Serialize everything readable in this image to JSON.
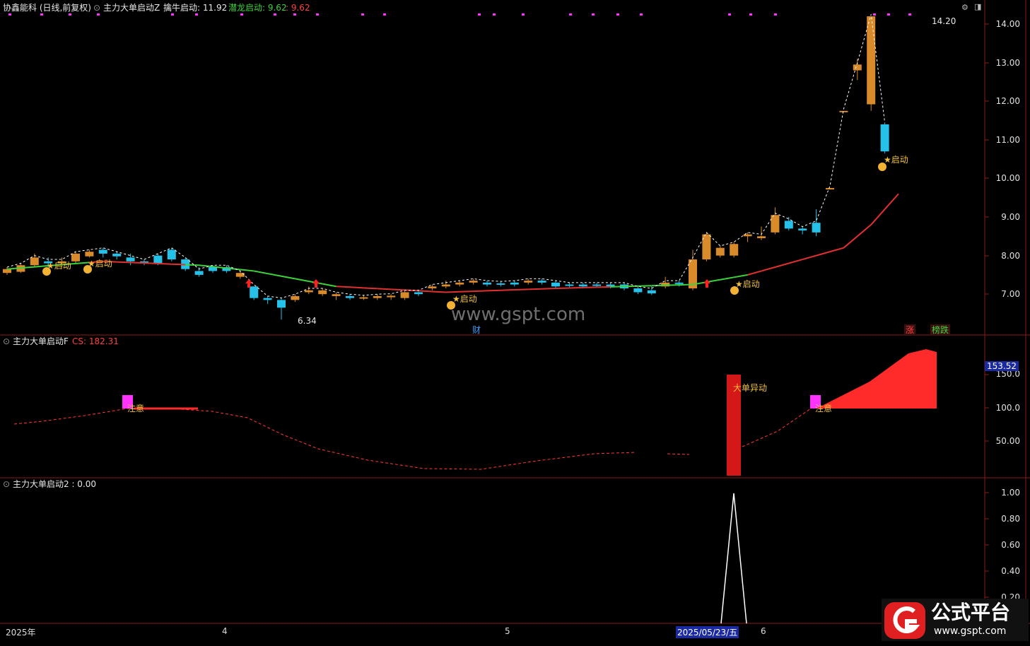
{
  "header": {
    "stock": "协鑫能科 (日线,前复权)",
    "indicator1": "主力大单启动Z",
    "qn_label": "擒牛启动: 11.92",
    "ql_label": "潜龙启动: 9.62",
    "ql_extra": ": 9.62"
  },
  "panel2": {
    "title": "主力大单启动F",
    "cs_label": "CS: 182.31",
    "current_value": "153.52",
    "event_label": "大单异动",
    "note_label": "注意"
  },
  "panel3": {
    "title": "主力大单启动2 : 0.00"
  },
  "main": {
    "high_label": "14.20",
    "low_label": "6.34",
    "start_label": "★启动",
    "fin_label": "财",
    "zhang_label": "涨",
    "bang_label": "榜跌",
    "watermark": "www.gspt.com"
  },
  "price_axis": [
    "14.00",
    "13.00",
    "12.00",
    "11.00",
    "10.00",
    "9.00",
    "8.00",
    "7.00"
  ],
  "cs_axis": [
    "150.0",
    "100.0",
    "50.00"
  ],
  "sig_axis": [
    "1.00",
    "0.80",
    "0.60",
    "0.40",
    "0.20"
  ],
  "x_axis": {
    "year": "2025年",
    "m4": "4",
    "m5": "5",
    "date": "2025/05/23/五",
    "m6": "6"
  },
  "brand": {
    "name": "公式平台",
    "url": "www.gspt.com"
  },
  "colors": {
    "up": "#d98a2b",
    "down": "#26c1e8",
    "ma_up": "#e03030",
    "ma_down": "#3cd23c",
    "pink": "#ff33ff",
    "red": "#ff2a2a"
  },
  "chart_data": {
    "type": "candlestick",
    "series": [
      {
        "name": "K线",
        "values": [
          [
            7.55,
            7.65,
            7.7,
            7.5
          ],
          [
            7.58,
            7.75,
            7.8,
            7.55
          ],
          [
            7.75,
            7.95,
            8.05,
            7.7
          ],
          [
            7.85,
            7.8,
            7.95,
            7.7
          ],
          [
            7.8,
            7.85,
            7.95,
            7.7
          ],
          [
            7.85,
            8.05,
            8.1,
            7.8
          ],
          [
            7.98,
            8.1,
            8.15,
            7.95
          ],
          [
            8.15,
            8.05,
            8.2,
            7.95
          ],
          [
            8.05,
            7.98,
            8.1,
            7.9
          ],
          [
            7.95,
            7.85,
            8.05,
            7.75
          ],
          [
            7.85,
            7.82,
            7.9,
            7.75
          ],
          [
            8.0,
            7.8,
            8.05,
            7.75
          ],
          [
            8.15,
            7.9,
            8.2,
            7.85
          ],
          [
            7.9,
            7.65,
            7.95,
            7.6
          ],
          [
            7.6,
            7.5,
            7.7,
            7.45
          ],
          [
            7.7,
            7.6,
            7.75,
            7.55
          ],
          [
            7.7,
            7.6,
            7.75,
            7.55
          ],
          [
            7.45,
            7.55,
            7.6,
            7.4
          ],
          [
            7.2,
            6.9,
            7.2,
            6.85
          ],
          [
            6.9,
            6.85,
            6.95,
            6.75
          ],
          [
            6.85,
            6.65,
            6.9,
            6.34
          ],
          [
            6.85,
            6.95,
            7.0,
            6.8
          ],
          [
            7.05,
            7.1,
            7.2,
            7.0
          ],
          [
            7.0,
            7.1,
            7.15,
            6.95
          ],
          [
            6.95,
            7.0,
            7.05,
            6.85
          ],
          [
            6.95,
            6.9,
            7.0,
            6.85
          ],
          [
            6.9,
            6.92,
            6.98,
            6.85
          ],
          [
            6.9,
            6.95,
            7.0,
            6.85
          ],
          [
            6.92,
            6.96,
            7.0,
            6.85
          ],
          [
            6.9,
            7.05,
            7.1,
            6.85
          ],
          [
            7.05,
            7.0,
            7.1,
            6.95
          ],
          [
            7.15,
            7.2,
            7.25,
            7.1
          ],
          [
            7.2,
            7.25,
            7.35,
            7.15
          ],
          [
            7.25,
            7.3,
            7.35,
            7.2
          ],
          [
            7.3,
            7.35,
            7.4,
            7.25
          ],
          [
            7.3,
            7.25,
            7.35,
            7.2
          ],
          [
            7.28,
            7.25,
            7.32,
            7.2
          ],
          [
            7.3,
            7.25,
            7.35,
            7.2
          ],
          [
            7.3,
            7.35,
            7.4,
            7.25
          ],
          [
            7.35,
            7.3,
            7.4,
            7.25
          ],
          [
            7.3,
            7.2,
            7.35,
            7.15
          ],
          [
            7.25,
            7.22,
            7.3,
            7.18
          ],
          [
            7.25,
            7.2,
            7.3,
            7.15
          ],
          [
            7.25,
            7.22,
            7.3,
            7.18
          ],
          [
            7.25,
            7.2,
            7.3,
            7.15
          ],
          [
            7.25,
            7.15,
            7.3,
            7.1
          ],
          [
            7.15,
            7.05,
            7.2,
            7.0
          ],
          [
            7.1,
            7.02,
            7.2,
            6.98
          ],
          [
            7.2,
            7.3,
            7.45,
            7.15
          ],
          [
            7.3,
            7.28,
            7.35,
            7.2
          ],
          [
            7.15,
            7.9,
            8.15,
            7.1
          ],
          [
            7.9,
            8.55,
            8.6,
            7.85
          ],
          [
            8.0,
            8.2,
            8.25,
            7.95
          ],
          [
            8.0,
            8.3,
            8.35,
            7.95
          ],
          [
            8.5,
            8.55,
            8.6,
            8.35
          ],
          [
            8.45,
            8.5,
            8.75,
            8.4
          ],
          [
            8.6,
            9.05,
            9.25,
            8.55
          ],
          [
            8.9,
            8.7,
            9.0,
            8.65
          ],
          [
            8.7,
            8.65,
            8.75,
            8.55
          ],
          [
            8.85,
            8.6,
            9.2,
            8.5
          ],
          [
            9.75,
            9.75,
            9.75,
            9.75
          ],
          [
            11.75,
            11.75,
            11.75,
            11.75
          ],
          [
            12.8,
            12.95,
            13.1,
            12.55
          ],
          [
            11.92,
            14.2,
            14.2,
            11.75
          ],
          [
            11.4,
            10.7,
            11.45,
            10.65
          ]
        ]
      },
      {
        "name": "CS",
        "values": []
      },
      {
        "name": "信号",
        "values": []
      }
    ]
  }
}
